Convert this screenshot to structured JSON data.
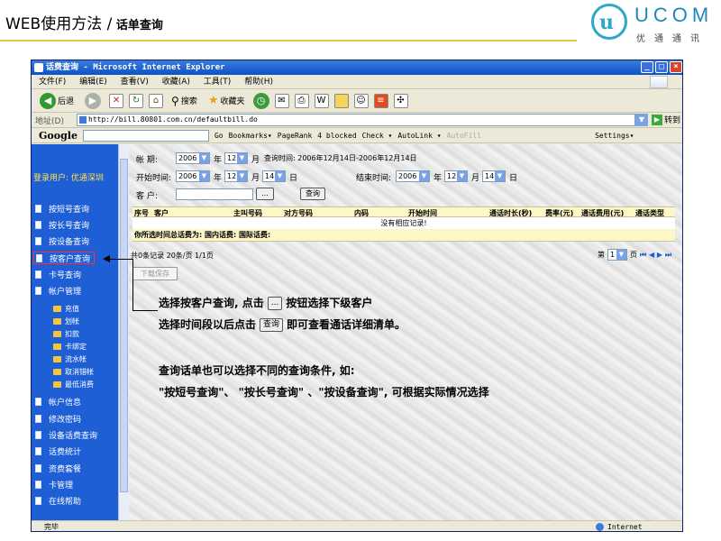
{
  "slide": {
    "title_main": "WEB使用方法 /",
    "title_sub": " 话单查询",
    "logo_letter": "u",
    "logo_text": "UCOM",
    "logo_cn": "优通通讯"
  },
  "browser": {
    "window_title": "话费查询 - Microsoft Internet Explorer",
    "menu": [
      "文件(F)",
      "编辑(E)",
      "查看(V)",
      "收藏(A)",
      "工具(T)",
      "帮助(H)"
    ],
    "toolbar": {
      "back": "后退",
      "search": "搜索",
      "favorites": "收藏夹"
    },
    "address_label": "地址(D)",
    "address_url": "http://bill.80801.com.cn/defaultbill.do",
    "go_label": "转到",
    "google_bar": {
      "logo": "Google",
      "go": "Go",
      "bookmarks": "Bookmarks▾",
      "pagerank": "PageRank",
      "blocked": "4 blocked",
      "check": "Check ▾",
      "autolink": "AutoLink ▾",
      "autofill": "AutoFill",
      "settings": "Settings▾"
    },
    "status": {
      "text": "完毕",
      "zone": "Internet"
    }
  },
  "sidebar": {
    "login_user": "登录用户: 优通深圳",
    "items": [
      "按短号查询",
      "按长号查询",
      "按设备查询",
      "按客户查询",
      "卡号查询",
      "帐户管理"
    ],
    "sub_items": [
      "充值",
      "划帐",
      "扣款",
      "卡绑定",
      "流水帐",
      "取消错帐",
      "最低消费"
    ],
    "items2": [
      "帐户信息",
      "修改密码",
      "设备话费查询",
      "话费统计",
      "资费套餐",
      "卡管理",
      "在线帮助"
    ]
  },
  "form": {
    "account_period_label": "帐    期:",
    "year": "2006",
    "month": "12",
    "year_unit": "年",
    "month_unit": "月",
    "day_unit": "日",
    "query_time": "查询时间: 2006年12月14日-2006年12月14日",
    "start_label": "开始时间:",
    "end_label": "结束时间:",
    "day": "14",
    "customer_label": "客    户:",
    "browse_button": "...",
    "query_button": "查询"
  },
  "grid": {
    "columns": [
      "序号",
      "客户",
      "主叫号码",
      "对方号码",
      "内码",
      "开始时间",
      "通话时长(秒)",
      "费率(元)",
      "通话费用(元)",
      "通话类型"
    ],
    "empty_message": "没有相应记录!",
    "summary": "你所选时间总话费为: 国内话费: 国际话费:"
  },
  "pager": {
    "info": "共0条记录 20条/页 1/1页",
    "page_prefix": "第",
    "page_value": "1",
    "page_suffix": "页",
    "arrows": "⏮ ◀ ▶ ⏭",
    "download": "下载保存"
  },
  "notes": {
    "line1a": "选择按客户查询, 点击",
    "line1_btn": "...",
    "line1b": "按钮选择下级客户",
    "line2a": "选择时间段以后点击",
    "line2_btn": "查询",
    "line2b": "即可查看通话详细清单。",
    "line3": "查询话单也可以选择不同的查询条件, 如:",
    "line4": "\"按短号查询\"、 \"按长号查询\" 、\"按设备查询\", 可根据实际情况选择"
  },
  "colors": {
    "sidebar_bg": "#1e5fd6",
    "title_bar": "#0a52c8",
    "grid_header": "#fdf7c8",
    "login_user": "#ffe44a"
  }
}
